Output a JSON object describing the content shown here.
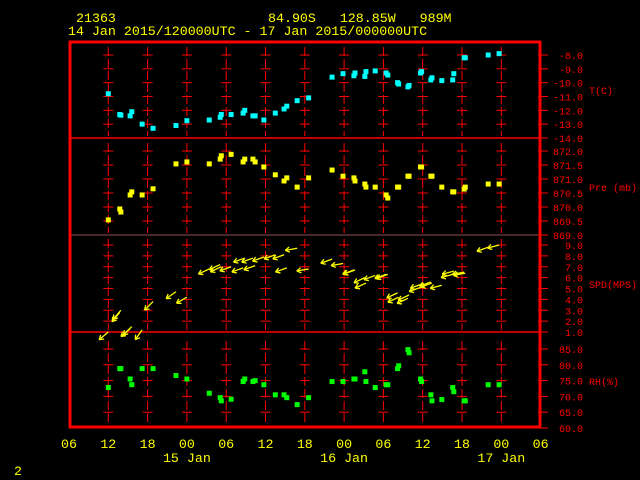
{
  "header": {
    "station_id": "21363",
    "location": "84.90S   128.85W   989M",
    "period": "14 Jan 2015/120000UTC - 17 Jan 2015/000000UTC"
  },
  "footer": {
    "page_number": "2"
  },
  "colors": {
    "frame": "#ff0000",
    "text": "#ffff00",
    "temperature": "#00ffff",
    "pressure": "#ffff00",
    "wind": "#ffff00",
    "humidity": "#00ff00"
  },
  "chart_data": {
    "type": "scatter",
    "x_axis": {
      "tick_labels": [
        "06",
        "12",
        "18",
        "00",
        "06",
        "12",
        "18",
        "00",
        "06",
        "12",
        "18",
        "00",
        "06"
      ],
      "date_labels": [
        {
          "text": "15 Jan",
          "at": "15 00:00"
        },
        {
          "text": "16 Jan",
          "at": "16 00:00"
        },
        {
          "text": "17 Jan",
          "at": "17 00:00"
        }
      ],
      "range": [
        "14 06:00",
        "17 06:00"
      ]
    },
    "panels": [
      {
        "key": "temp",
        "label": "T(C)",
        "ylim": [
          -14,
          -8
        ],
        "ticks": [
          "-8.0",
          "-9.0",
          "-10.0",
          "-11.0",
          "-12.0",
          "-13.0",
          "-14.0"
        ],
        "tick_values": [
          -8,
          -9,
          -10,
          -11,
          -12,
          -13,
          -14
        ],
        "marker": "square",
        "color": "#00ffff"
      },
      {
        "key": "pres",
        "label": "Pre (mb)",
        "ylim": [
          869,
          872
        ],
        "ticks": [
          "872.0",
          "871.5",
          "871.0",
          "870.5",
          "870.0",
          "869.5",
          "869.0"
        ],
        "tick_values": [
          872,
          871.5,
          871,
          870.5,
          870,
          869.5,
          869
        ],
        "marker": "square",
        "color": "#ffff00"
      },
      {
        "key": "spd",
        "label": "SPD(MPS)",
        "ylim": [
          1,
          9
        ],
        "ticks": [
          "9.0",
          "8.0",
          "7.0",
          "6.0",
          "5.0",
          "4.0",
          "3.0",
          "2.0",
          "1.0"
        ],
        "tick_values": [
          9,
          8,
          7,
          6,
          5,
          4,
          3,
          2,
          1
        ],
        "marker": "wind-arrow",
        "color": "#ffff00"
      },
      {
        "key": "rh",
        "label": "RH(%)",
        "ylim": [
          60,
          85
        ],
        "ticks": [
          "85.0",
          "80.0",
          "75.0",
          "70.0",
          "65.0",
          "60.0"
        ],
        "tick_values": [
          85,
          80,
          75,
          70,
          65,
          60
        ],
        "marker": "square",
        "color": "#00ff00"
      }
    ],
    "times": [
      "14 12:00",
      "14 13:45",
      "14 13:55",
      "14 15:20",
      "14 15:35",
      "14 17:10",
      "14 18:50",
      "14 22:20",
      "15 00:00",
      "15 03:25",
      "15 05:05",
      "15 05:15",
      "15 06:45",
      "15 08:35",
      "15 08:50",
      "15 10:05",
      "15 10:25",
      "15 11:45",
      "15 13:30",
      "15 14:50",
      "15 15:15",
      "15 16:50",
      "15 18:35",
      "15 22:10",
      "15 23:50",
      "16 01:30",
      "16 01:40",
      "16 03:10",
      "16 03:20",
      "16 04:45",
      "16 06:25",
      "16 06:40",
      "16 08:10",
      "16 08:20",
      "16 09:45",
      "16 09:55",
      "16 11:40",
      "16 11:50",
      "16 13:15",
      "16 13:25",
      "16 14:55",
      "16 16:35",
      "16 16:45",
      "16 18:20",
      "16 18:30",
      "16 22:00",
      "16 23:40"
    ],
    "series": {
      "temp": [
        -10.8,
        -12.3,
        -12.35,
        -12.4,
        -12.1,
        -13.0,
        -13.3,
        -13.1,
        -12.75,
        -12.7,
        -12.5,
        -12.3,
        -12.3,
        -12.2,
        -12.0,
        -12.4,
        -12.4,
        -12.7,
        -12.2,
        -11.9,
        -11.7,
        -11.3,
        -11.1,
        -9.6,
        -9.35,
        -9.5,
        -9.3,
        -9.55,
        -9.2,
        -9.15,
        -9.3,
        -9.45,
        -10.0,
        -10.1,
        -10.3,
        -10.2,
        -9.3,
        -9.2,
        -9.8,
        -9.65,
        -9.85,
        -9.8,
        -9.35,
        -8.2,
        -8.2,
        -8.0,
        -7.9
      ],
      "pres": [
        869.54,
        869.93,
        869.82,
        870.43,
        870.54,
        870.43,
        870.65,
        871.54,
        871.61,
        871.54,
        871.71,
        871.83,
        871.88,
        871.61,
        871.71,
        871.71,
        871.61,
        871.43,
        871.15,
        870.93,
        871.04,
        870.71,
        871.04,
        871.32,
        871.1,
        871.04,
        870.93,
        870.82,
        870.71,
        870.71,
        870.43,
        870.32,
        870.71,
        870.71,
        871.1,
        871.1,
        871.43,
        871.43,
        871.1,
        871.1,
        870.71,
        870.54,
        870.54,
        870.64,
        870.71,
        870.82,
        870.82
      ],
      "spd": [
        1.0,
        2.8,
        3.0,
        1.3,
        1.5,
        1.2,
        3.8,
        4.7,
        4.2,
        6.8,
        7.2,
        7.0,
        7.0,
        6.9,
        7.8,
        7.8,
        7.1,
        7.9,
        8.1,
        8.1,
        6.9,
        8.7,
        6.8,
        7.7,
        7.3,
        6.7,
        6.7,
        6.0,
        5.5,
        6.2,
        6.3,
        6.3,
        4.6,
        4.2,
        4.1,
        4.4,
        5.1,
        5.4,
        5.6,
        5.5,
        5.3,
        6.3,
        6.6,
        6.5,
        6.4,
        8.8,
        9.0
      ],
      "dir": [
        50,
        40,
        40,
        50,
        45,
        35,
        45,
        55,
        60,
        65,
        65,
        65,
        70,
        70,
        70,
        70,
        70,
        70,
        70,
        70,
        70,
        80,
        80,
        70,
        80,
        70,
        70,
        65,
        65,
        70,
        70,
        70,
        65,
        65,
        65,
        65,
        70,
        70,
        70,
        70,
        75,
        75,
        75,
        80,
        80,
        70,
        75
      ],
      "rh": [
        72.8,
        78.8,
        78.8,
        75.5,
        73.7,
        78.8,
        78.8,
        76.6,
        75.5,
        71.0,
        69.6,
        68.6,
        69.1,
        74.7,
        75.5,
        74.7,
        75.0,
        73.7,
        70.5,
        70.5,
        69.6,
        67.4,
        69.6,
        74.7,
        74.7,
        75.5,
        75.5,
        77.8,
        74.7,
        72.8,
        73.7,
        73.7,
        78.8,
        79.7,
        84.8,
        83.8,
        75.5,
        74.7,
        70.5,
        68.6,
        69.0,
        72.8,
        71.5,
        68.6,
        68.6,
        73.7,
        73.7
      ]
    }
  }
}
